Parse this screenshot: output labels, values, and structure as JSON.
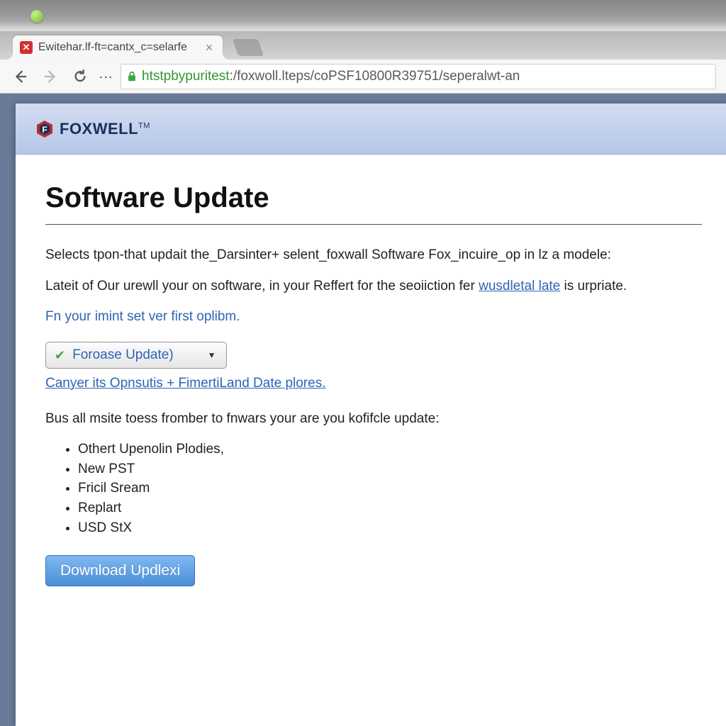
{
  "browser": {
    "tab_title": "Ewitehar.lf-ft=cantx_c=selarfe",
    "url_green": "htstpbypuritest",
    "url_rest": ":/foxwoll.lteps/coPSF10800R39751/seperalwt-an"
  },
  "header": {
    "brand": "FOXWELL",
    "tm": "TM"
  },
  "content": {
    "title": "Software Update",
    "para1": "Selects tpon-that updait the_Darsinter+ selent_foxwall Software Fox_incuire_op in lz a modele:",
    "para2a": "Lateit of Our urewll your on software, in your Reffert for the seoiiction fer ",
    "para2_link": "wusdletal late",
    "para2b": " is urpriate.",
    "helper": "Fn your imint set ver first oplibm.",
    "dropdown_label": "Foroase Update)",
    "sub_link": "Canyer its Opnsutis + FimertiLand Date plores.",
    "para3": "Bus all msite toess fromber to fnwars your are you kofifcle update:",
    "features": [
      "Othert Upenolin Plodies,",
      "New PST",
      "Fricil Sream",
      "Replart",
      "USD StX"
    ],
    "download_label": "Download Updlexi"
  }
}
